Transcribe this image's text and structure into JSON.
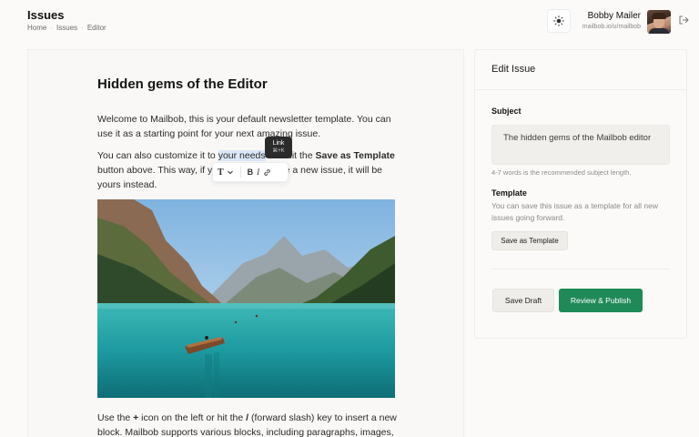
{
  "header": {
    "title": "Issues",
    "breadcrumb": [
      "Home",
      "Issues",
      "Editor"
    ],
    "breadcrumb_sep": "·",
    "user": {
      "name": "Bobby Mailer",
      "email": "mailbob.io/u/mailbob"
    },
    "icons": {
      "theme": "sun-icon",
      "logout": "logout-icon"
    }
  },
  "editor": {
    "title": "Hidden gems of the Editor",
    "p1": "Welcome to Mailbob, this is your default newsletter template. You can use it as a starting point for your next amazing issue.",
    "p2_a": "You can also customize it to ",
    "p2_hl": "your needs",
    "p2_b": " and hit the ",
    "p2_bold": "Save as Template",
    "p2_c": " button above. This way, if you choose to write a new issue, it will be yours instead.",
    "p3_a": "Use the ",
    "p3_plus": "+",
    "p3_b": " icon on the left or hit the ",
    "p3_slash": "/",
    "p3_c": " (forward slash) key to insert a new block. Mailbob supports various blocks, including paragraphs, images,",
    "image_icon": "mountain-lake-image",
    "toolbar": {
      "tooltip_label": "Link",
      "tooltip_shortcut": "⌘+K",
      "text_style": "T",
      "bold": "B",
      "italic": "I"
    }
  },
  "sidebar": {
    "title": "Edit Issue",
    "subject_label": "Subject",
    "subject_value": "The hidden gems of the Mailbob editor",
    "subject_hint": "4-7 words is the recommended subject length.",
    "template_label": "Template",
    "template_desc": "You can save this issue as a template for all new issues going forward.",
    "save_template": "Save as Template",
    "save_draft": "Save Draft",
    "publish": "Review & Publish"
  },
  "colors": {
    "accent": "#1f8a58",
    "highlight": "#dbe8f8",
    "background": "#fbfaf8"
  }
}
